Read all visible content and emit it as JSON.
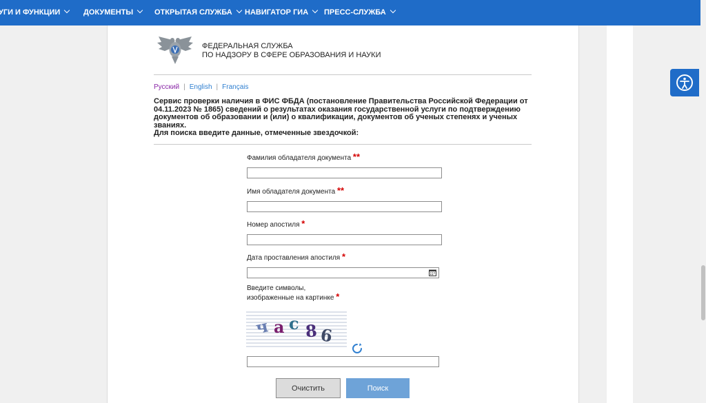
{
  "nav": {
    "items": [
      {
        "label": "УГИ И ФУНКЦИИ"
      },
      {
        "label": "ДОКУМЕНТЫ"
      },
      {
        "label": "ОТКРЫТАЯ СЛУЖБА"
      },
      {
        "label": "НАВИГАТОР ГИА"
      },
      {
        "label": "ПРЕСС-СЛУЖБА"
      }
    ],
    "color": "#1f6cc8"
  },
  "header": {
    "agency_line1": "ФЕДЕРАЛЬНАЯ СЛУЖБА",
    "agency_line2": "ПО НАДЗОРУ В СФЕРЕ ОБРАЗОВАНИЯ И НАУКИ"
  },
  "languages": {
    "active": "Русский",
    "english": "English",
    "french": "Français",
    "separator": "|"
  },
  "intro": {
    "line1": "Сервис проверки наличия в ФИС ФБДА (постановление Правительства Российской Федерации от",
    "line2": "04.11.2023 № 1865) сведений о результатах оказания государственной услуги по подтверждению",
    "line3": "документов об образовании и (или) о квалификации, документов об ученых степенях и ученых званиях.",
    "line4": "Для поиска введите данные, отмеченные звездочкой:"
  },
  "form": {
    "surname": {
      "label": "Фамилия обладателя документа",
      "required_mark": "**",
      "value": ""
    },
    "name": {
      "label": "Имя обладателя документа",
      "required_mark": "**",
      "value": ""
    },
    "apostille_number": {
      "label": "Номер апостиля",
      "required_mark": "*",
      "value": ""
    },
    "apostille_date": {
      "label": "Дата проставления апостиля",
      "required_mark": "*",
      "value": ""
    },
    "captcha": {
      "label_line1": "Введите символы,",
      "label_line2": "изображенные на картинке",
      "required_mark": "*",
      "text": "ЧАС86",
      "value": ""
    }
  },
  "buttons": {
    "clear": "Очистить",
    "search": "Поиск"
  },
  "icons": {
    "accessibility": "accessibility-icon",
    "calendar": "calendar-icon",
    "refresh": "refresh-icon",
    "logo": "eagle-emblem-logo"
  },
  "colors": {
    "accent": "#1f6cc8",
    "required": "#d40000",
    "search_button": "#6ea3d8"
  }
}
